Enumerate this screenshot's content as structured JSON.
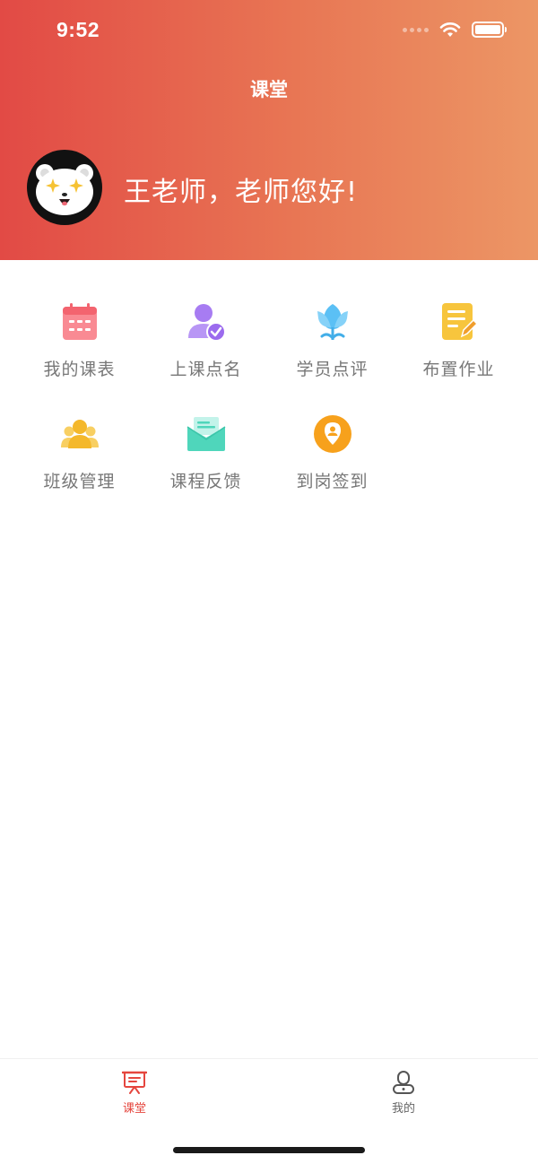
{
  "status_bar": {
    "time": "9:52"
  },
  "nav": {
    "title": "课堂"
  },
  "greeting": "王老师，老师您好!",
  "menu": [
    {
      "label": "我的课表",
      "icon": "calendar-icon",
      "color": "#f3707a"
    },
    {
      "label": "上课点名",
      "icon": "roll-call-icon",
      "color": "#a77cf2"
    },
    {
      "label": "学员点评",
      "icon": "tulip-icon",
      "color": "#5bc0f5"
    },
    {
      "label": "布置作业",
      "icon": "homework-icon",
      "color": "#f7c53d"
    },
    {
      "label": "班级管理",
      "icon": "class-group-icon",
      "color": "#f5be36"
    },
    {
      "label": "课程反馈",
      "icon": "feedback-envelope-icon",
      "color": "#4fd6bb"
    },
    {
      "label": "到岗签到",
      "icon": "check-in-location-icon",
      "color": "#f7a11c"
    }
  ],
  "tabbar": {
    "active_color": "#e5463e",
    "inactive_color": "#666666",
    "tabs": [
      {
        "label": "课堂",
        "icon": "classroom-icon",
        "active": true
      },
      {
        "label": "我的",
        "icon": "profile-icon",
        "active": false
      }
    ]
  }
}
